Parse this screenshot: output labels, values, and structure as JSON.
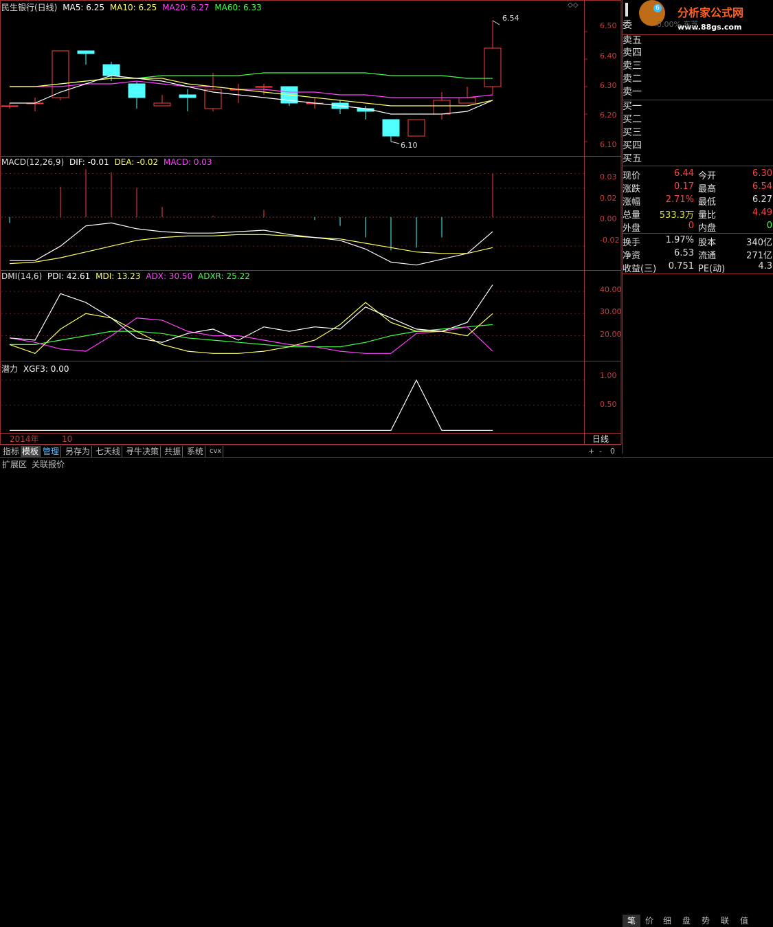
{
  "main_pane": {
    "title": "民生银行(日线)",
    "ma5": "MA5: 6.25",
    "ma10": "MA10: 6.25",
    "ma20": "MA20: 6.27",
    "ma60": "MA60: 6.33",
    "high_mark": "6.54",
    "low_mark": "6.10",
    "y_ticks": [
      "6.50",
      "6.40",
      "6.30",
      "6.20",
      "6.10"
    ]
  },
  "macd_pane": {
    "title": "MACD(12,26,9)",
    "dif": "DIF: -0.01",
    "dea": "DEA: -0.02",
    "macd": "MACD: 0.03",
    "y_ticks": [
      "0.03",
      "0.02",
      "0.00",
      "-0.02"
    ]
  },
  "dmi_pane": {
    "title": "DMI(14,6)",
    "pdi": "PDI: 42.61",
    "mdi": "MDI: 13.23",
    "adx": "ADX: 30.50",
    "adxr": "ADXR: 25.22",
    "y_ticks": [
      "40.00",
      "30.00",
      "20.00"
    ]
  },
  "xgf_pane": {
    "title": "潜力",
    "xgf": "XGF3: 0.00",
    "y_ticks": [
      "1.00",
      "0.50"
    ]
  },
  "time_axis": {
    "year": "2014年",
    "month": "10",
    "period": "日线"
  },
  "bottom_tabs": [
    "指标",
    "模板",
    "管理",
    "另存为",
    "七天线",
    "寻牛决策",
    "共振",
    "系统",
    "cvx"
  ],
  "bottom_controls": [
    "+",
    "-",
    "0"
  ],
  "status_bar": [
    "扩展区",
    "关联报价"
  ],
  "logo": {
    "text": "分析家公式网",
    "url": "www.88gs.com",
    "badge": "6",
    "partial": "0.00% 东芝"
  },
  "order_book": {
    "sell": [
      "卖五",
      "卖四",
      "卖三",
      "卖二",
      "卖一"
    ],
    "sell_first_partial": "委",
    "buy": [
      "买一",
      "买二",
      "买三",
      "买四",
      "买五"
    ]
  },
  "quote": [
    {
      "l1": "现价",
      "v1": "6.44",
      "c1": "#ff4040",
      "l2": "今开",
      "v2": "6.30",
      "c2": "#ff4040"
    },
    {
      "l1": "涨跌",
      "v1": "0.17",
      "c1": "#ff4040",
      "l2": "最高",
      "v2": "6.54",
      "c2": "#ff4040"
    },
    {
      "l1": "涨幅",
      "v1": "2.71%",
      "c1": "#ff4040",
      "l2": "最低",
      "v2": "6.27",
      "c2": "#e0e0e0"
    },
    {
      "l1": "总量",
      "v1": "533.3万",
      "c1": "#e0e040",
      "l2": "量比",
      "v2": "4.49",
      "c2": "#ff4040"
    },
    {
      "l1": "外盘",
      "v1": "0",
      "c1": "#ff4040",
      "l2": "内盘",
      "v2": "0",
      "c2": "#40ff40"
    }
  ],
  "fundamentals": [
    {
      "l1": "换手",
      "v1": "1.97%",
      "l2": "股本",
      "v2": "340亿"
    },
    {
      "l1": "净资",
      "v1": "6.53",
      "l2": "流通",
      "v2": "271亿"
    },
    {
      "l1": "收益(三)",
      "v1": "0.751",
      "l2": "PE(动)",
      "v2": "4.3"
    }
  ],
  "right_tabs": [
    "笔",
    "价",
    "细",
    "盘",
    "势",
    "联",
    "值"
  ],
  "colors": {
    "up": "#ff4040",
    "down": "#50ffff",
    "frame": "#a03030",
    "ma5": "#ffffff",
    "ma10": "#ffff60",
    "ma20": "#ff40ff",
    "ma60": "#40ff40"
  },
  "chart_data": {
    "type": "candlestick",
    "price_axis": [
      6.05,
      6.58
    ],
    "candles": [
      {
        "o": 6.23,
        "c": 6.23,
        "h": 6.24,
        "l": 6.22
      },
      {
        "o": 6.24,
        "c": 6.24,
        "h": 6.26,
        "l": 6.21
      },
      {
        "o": 6.26,
        "c": 6.43,
        "h": 6.43,
        "l": 6.25
      },
      {
        "o": 6.43,
        "c": 6.42,
        "h": 6.43,
        "l": 6.38
      },
      {
        "o": 6.38,
        "c": 6.34,
        "h": 6.39,
        "l": 6.32
      },
      {
        "o": 6.31,
        "c": 6.26,
        "h": 6.32,
        "l": 6.22
      },
      {
        "o": 6.23,
        "c": 6.24,
        "h": 6.27,
        "l": 6.23
      },
      {
        "o": 6.27,
        "c": 6.26,
        "h": 6.29,
        "l": 6.21
      },
      {
        "o": 6.22,
        "c": 6.29,
        "h": 6.35,
        "l": 6.21
      },
      {
        "o": 6.29,
        "c": 6.29,
        "h": 6.31,
        "l": 6.24
      },
      {
        "o": 6.3,
        "c": 6.3,
        "h": 6.31,
        "l": 6.27
      },
      {
        "o": 6.3,
        "c": 6.24,
        "h": 6.3,
        "l": 6.23
      },
      {
        "o": 6.24,
        "c": 6.24,
        "h": 6.26,
        "l": 6.22
      },
      {
        "o": 6.24,
        "c": 6.22,
        "h": 6.25,
        "l": 6.2
      },
      {
        "o": 6.22,
        "c": 6.21,
        "h": 6.23,
        "l": 6.18
      },
      {
        "o": 6.18,
        "c": 6.12,
        "h": 6.18,
        "l": 6.1
      },
      {
        "o": 6.12,
        "c": 6.18,
        "h": 6.18,
        "l": 6.12
      },
      {
        "o": 6.2,
        "c": 6.25,
        "h": 6.28,
        "l": 6.18
      },
      {
        "o": 6.24,
        "c": 6.26,
        "h": 6.3,
        "l": 6.24
      },
      {
        "o": 6.3,
        "c": 6.44,
        "h": 6.54,
        "l": 6.27
      }
    ],
    "ma5": [
      6.24,
      6.24,
      6.28,
      6.31,
      6.34,
      6.33,
      6.32,
      6.3,
      6.28,
      6.27,
      6.26,
      6.25,
      6.24,
      6.23,
      6.22,
      6.2,
      6.2,
      6.2,
      6.21,
      6.25
    ],
    "ma10": [
      6.3,
      6.3,
      6.31,
      6.32,
      6.33,
      6.33,
      6.33,
      6.31,
      6.3,
      6.29,
      6.28,
      6.27,
      6.26,
      6.25,
      6.24,
      6.23,
      6.23,
      6.23,
      6.23,
      6.25
    ],
    "ma20": [
      6.3,
      6.3,
      6.3,
      6.31,
      6.31,
      6.32,
      6.31,
      6.3,
      6.3,
      6.29,
      6.29,
      6.28,
      6.28,
      6.27,
      6.27,
      6.26,
      6.26,
      6.26,
      6.26,
      6.27
    ],
    "ma60": [
      6.3,
      6.3,
      6.31,
      6.32,
      6.33,
      6.33,
      6.34,
      6.34,
      6.34,
      6.34,
      6.35,
      6.35,
      6.35,
      6.35,
      6.35,
      6.34,
      6.34,
      6.34,
      6.33,
      6.33
    ],
    "macd_axis": [
      -0.036,
      0.036
    ],
    "macd_bars": [
      -0.004,
      0.0,
      0.021,
      0.033,
      0.031,
      0.02,
      0.007,
      0.0,
      0.001,
      0.0,
      0.005,
      0.0,
      -0.002,
      -0.006,
      -0.014,
      -0.023,
      -0.021,
      -0.014,
      0.0,
      0.03
    ],
    "dif": [
      -0.03,
      -0.03,
      -0.02,
      -0.006,
      -0.004,
      -0.008,
      -0.01,
      -0.011,
      -0.011,
      -0.01,
      -0.009,
      -0.012,
      -0.014,
      -0.016,
      -0.022,
      -0.031,
      -0.033,
      -0.029,
      -0.025,
      -0.01
    ],
    "dea": [
      -0.032,
      -0.031,
      -0.028,
      -0.024,
      -0.02,
      -0.016,
      -0.014,
      -0.013,
      -0.013,
      -0.012,
      -0.012,
      -0.013,
      -0.014,
      -0.015,
      -0.018,
      -0.021,
      -0.024,
      -0.025,
      -0.025,
      -0.021
    ],
    "dmi_axis": [
      9,
      45
    ],
    "pdi": [
      19,
      18,
      39,
      35,
      28,
      19,
      17,
      21,
      23,
      18,
      24,
      22,
      24,
      23,
      33,
      28,
      23,
      22,
      26,
      43
    ],
    "mdi": [
      16,
      12,
      23,
      30,
      28,
      22,
      16,
      13,
      12,
      12,
      13,
      15,
      18,
      25,
      35,
      26,
      22,
      22,
      20,
      30
    ],
    "adx": [
      19,
      17,
      14,
      13,
      20,
      28,
      27,
      22,
      20,
      20,
      18,
      16,
      15,
      13,
      12,
      12,
      21,
      22,
      24,
      13
    ],
    "adxr": [
      16,
      16,
      18,
      20,
      22,
      22,
      21,
      19,
      18,
      17,
      16,
      15,
      15,
      15,
      17,
      20,
      22,
      23,
      24,
      25
    ],
    "xgf_axis": [
      -0.05,
      1.18
    ],
    "xgf3": [
      0,
      0,
      0,
      0,
      0,
      0,
      0,
      0,
      0,
      0,
      0,
      0,
      0,
      0,
      0,
      0,
      1,
      0,
      0,
      0
    ]
  }
}
